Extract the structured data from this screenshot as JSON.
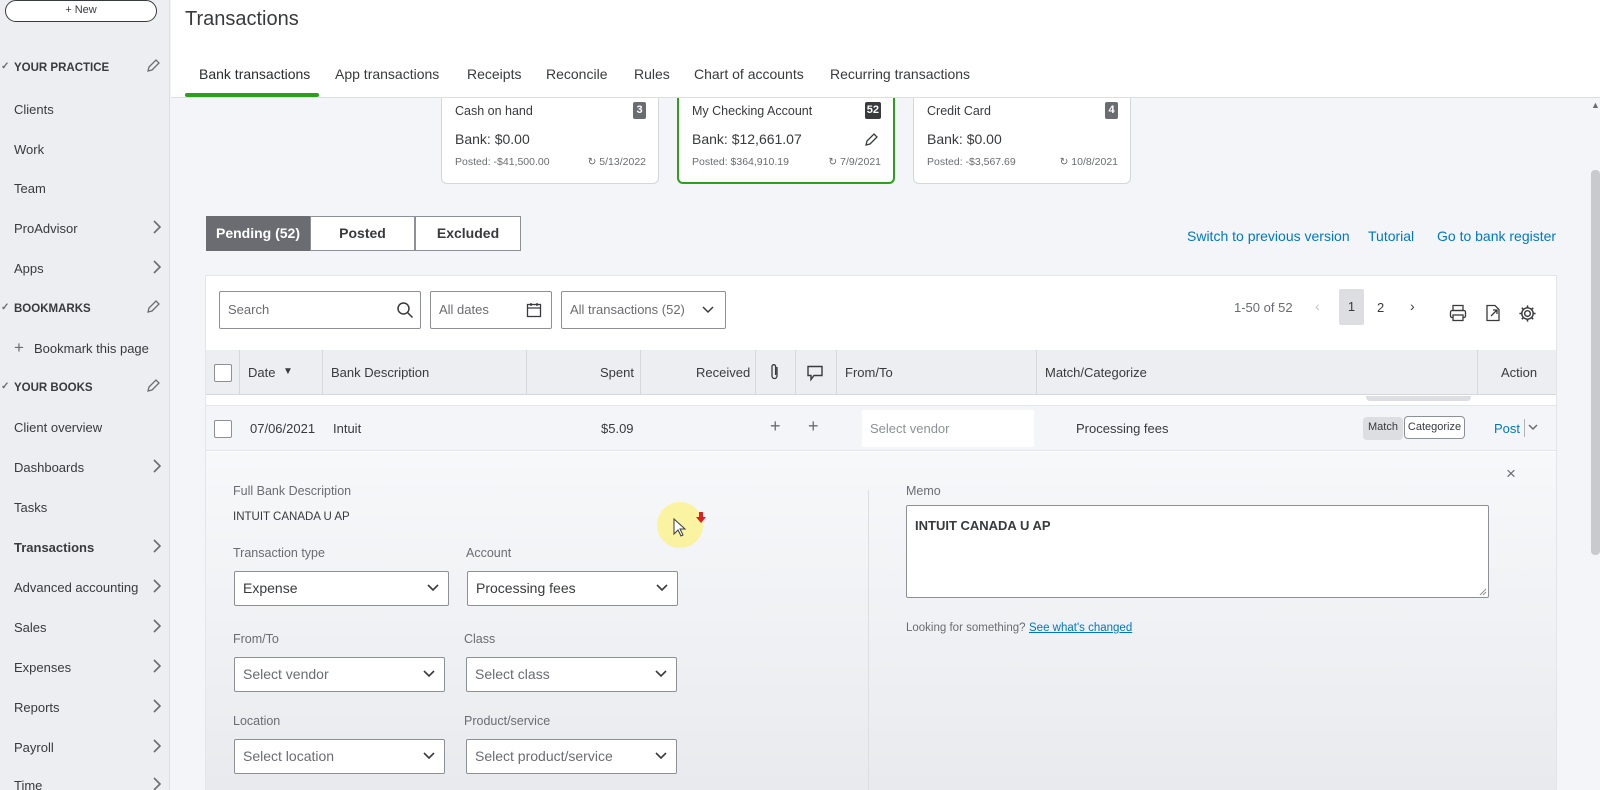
{
  "sidebar": {
    "new_label": "+ New",
    "your_practice": "YOUR PRACTICE",
    "practice_items": [
      "Clients",
      "Work",
      "Team",
      "ProAdvisor",
      "Apps"
    ],
    "bookmarks": "BOOKMARKS",
    "bookmark_page": "Bookmark this page",
    "your_books": "YOUR BOOKS",
    "books_items": [
      "Client overview",
      "Dashboards",
      "Tasks",
      "Transactions",
      "Advanced accounting",
      "Sales",
      "Expenses",
      "Reports",
      "Payroll",
      "Time"
    ]
  },
  "header": {
    "title": "Transactions",
    "tabs": [
      "Bank transactions",
      "App transactions",
      "Receipts",
      "Reconcile",
      "Rules",
      "Chart of accounts",
      "Recurring transactions"
    ]
  },
  "accounts": [
    {
      "name": "Cash on hand",
      "count": "3",
      "bank": "Bank: $0.00",
      "posted": "Posted: -$41,500.00",
      "date": "5/13/2022"
    },
    {
      "name": "My Checking Account",
      "count": "52",
      "bank": "Bank: $12,661.07",
      "posted": "Posted: $364,910.19",
      "date": "7/9/2021"
    },
    {
      "name": "Credit Card",
      "count": "4",
      "bank": "Bank: $0.00",
      "posted": "Posted: -$3,567.69",
      "date": "10/8/2021"
    }
  ],
  "filters": {
    "pending": "Pending (52)",
    "posted": "Posted",
    "excluded": "Excluded"
  },
  "links": {
    "switch": "Switch to previous version",
    "tutorial": "Tutorial",
    "register": "Go to bank register"
  },
  "toolbar": {
    "search_placeholder": "Search",
    "dates": "All dates",
    "transactions": "All transactions (52)",
    "range": "1-50 of 52",
    "page1": "1",
    "page2": "2"
  },
  "table": {
    "headers": {
      "date": "Date",
      "desc": "Bank Description",
      "spent": "Spent",
      "received": "Received",
      "fromto": "From/To",
      "match": "Match/Categorize",
      "action": "Action"
    },
    "row": {
      "date": "07/06/2021",
      "desc": "Intuit",
      "spent": "$5.09",
      "vendor_placeholder": "Select vendor",
      "category": "Processing fees",
      "match": "Match",
      "categorize": "Categorize",
      "post": "Post"
    }
  },
  "detail": {
    "full_desc_label": "Full Bank Description",
    "full_desc": "INTUIT CANADA U AP",
    "txn_type_label": "Transaction type",
    "txn_type": "Expense",
    "account_label": "Account",
    "account": "Processing fees",
    "fromto_label": "From/To",
    "vendor": "Select vendor",
    "class_label": "Class",
    "class": "Select class",
    "location_label": "Location",
    "location": "Select location",
    "product_label": "Product/service",
    "product": "Select product/service",
    "memo_label": "Memo",
    "memo": "INTUIT CANADA U  AP",
    "looking": "Looking for something?",
    "see_changed": "See what's changed"
  },
  "colors": {
    "accent": "#2ca01c",
    "link": "#0077c5",
    "text": "#393a3d"
  }
}
